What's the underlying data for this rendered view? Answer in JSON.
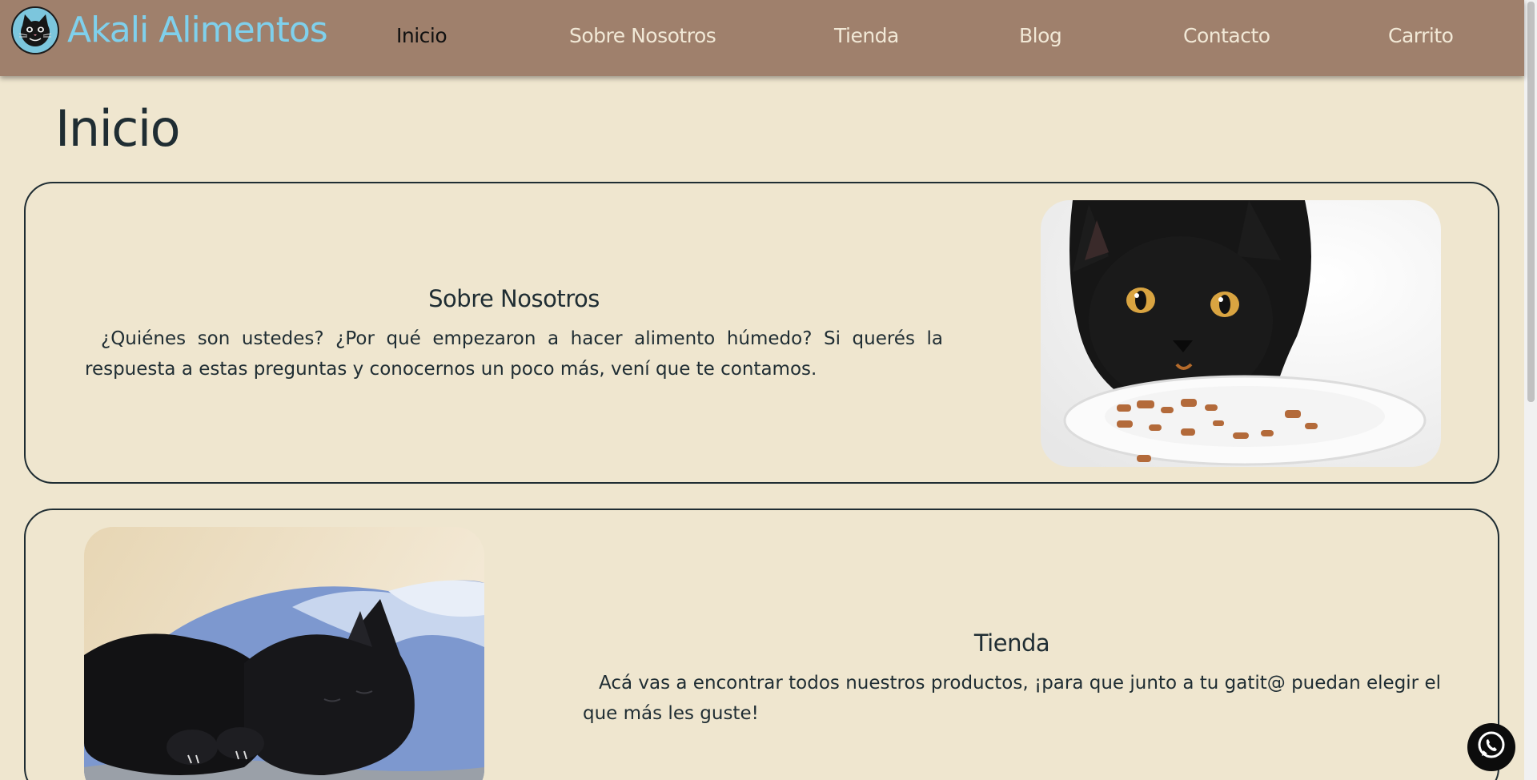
{
  "brand": {
    "logo_icon": "cat-face-icon",
    "name": "Akali Alimentos"
  },
  "nav": {
    "items": [
      {
        "label": "Inicio",
        "active": true
      },
      {
        "label": "Sobre Nosotros",
        "active": false
      },
      {
        "label": "Tienda",
        "active": false
      },
      {
        "label": "Blog",
        "active": false
      },
      {
        "label": "Contacto",
        "active": false
      },
      {
        "label": "Carrito",
        "active": false
      }
    ]
  },
  "page": {
    "title": "Inicio"
  },
  "sections": [
    {
      "title": "Sobre Nosotros",
      "text": "¿Quiénes son ustedes? ¿Por qué empezaron a hacer alimento húmedo? Si querés la respuesta a estas preguntas y conocernos un poco más, vení que te contamos.",
      "image": "black-cat-eating-photo"
    },
    {
      "title": "Tienda",
      "text": "Acá vas a encontrar todos nuestros productos, ¡para que junto a tu gatit@ puedan elegir el que más les guste!",
      "image": "black-cats-sleeping-photo"
    }
  ],
  "floating": {
    "icon": "whatsapp-icon"
  },
  "colors": {
    "header": "#9f806c",
    "background": "#efe6cf",
    "brand_text": "#7fd0ec",
    "text": "#1f2d33"
  }
}
